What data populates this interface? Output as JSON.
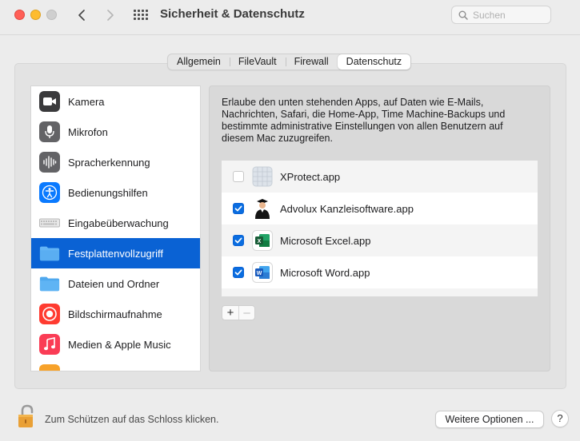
{
  "window": {
    "title": "Sicherheit & Datenschutz",
    "search_placeholder": "Suchen"
  },
  "tabs": [
    {
      "label": "Allgemein",
      "active": false
    },
    {
      "label": "FileVault",
      "active": false
    },
    {
      "label": "Firewall",
      "active": false
    },
    {
      "label": "Datenschutz",
      "active": true
    }
  ],
  "sidebar": {
    "items": [
      {
        "label": "Kamera",
        "icon": "camera-icon"
      },
      {
        "label": "Mikrofon",
        "icon": "microphone-icon"
      },
      {
        "label": "Spracherkennung",
        "icon": "speech-recognition-icon"
      },
      {
        "label": "Bedienungshilfen",
        "icon": "accessibility-icon"
      },
      {
        "label": "Eingabeüberwachung",
        "icon": "keyboard-icon"
      },
      {
        "label": "Festplattenvollzugriff",
        "icon": "folder-icon",
        "selected": true
      },
      {
        "label": "Dateien und Ordner",
        "icon": "folder-icon"
      },
      {
        "label": "Bildschirmaufnahme",
        "icon": "screen-recording-icon"
      },
      {
        "label": "Medien & Apple Music",
        "icon": "music-icon"
      }
    ]
  },
  "content": {
    "description": "Erlaube den unten stehenden Apps, auf Daten wie E-Mails, Nachrichten, Safari, die Home-App, Time Machine-Backups und bestimmte administrative Einstellungen von allen Benutzern auf diesem Mac zuzugreifen.",
    "apps": [
      {
        "name": "XProtect.app",
        "checked": false,
        "icon": "xprotect-icon"
      },
      {
        "name": "Advolux Kanzleisoftware.app",
        "checked": true,
        "icon": "advolux-icon"
      },
      {
        "name": "Microsoft Excel.app",
        "checked": true,
        "icon": "excel-icon"
      },
      {
        "name": "Microsoft Word.app",
        "checked": true,
        "icon": "word-icon"
      }
    ],
    "add_label": "+",
    "remove_label": "–"
  },
  "footer": {
    "lock_text": "Zum Schützen auf das Schloss klicken.",
    "more_options_label": "Weitere Optionen ...",
    "help_label": "?"
  },
  "colors": {
    "selection": "#0a62d4",
    "checkbox_on": "#0a6de0",
    "panel_bg": "#e3e3e3"
  }
}
